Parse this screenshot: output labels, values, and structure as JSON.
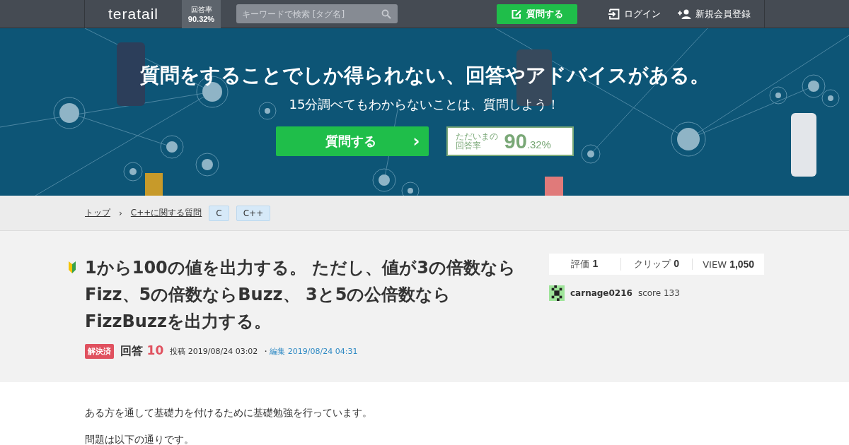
{
  "header": {
    "logo": "teratail",
    "answer_rate": {
      "label": "回答率",
      "value": "90.32%"
    },
    "search": {
      "placeholder": "キーワードで検索 [タグ名]"
    },
    "ask_button": "質問する",
    "login": "ログイン",
    "signup": "新規会員登録"
  },
  "hero": {
    "headline": "質問をすることでしか得られない、回答やアドバイスがある。",
    "subheading": "15分調べてもわからないことは、質問しよう！",
    "ask_button": "質問する",
    "arrow": "›",
    "rate_lines": [
      "ただいまの",
      "回答率"
    ],
    "rate_int": "90",
    "rate_dec": ".32%"
  },
  "breadcrumbs": [
    {
      "label": "トップ",
      "kind": "link"
    },
    {
      "label": "›",
      "kind": "sep"
    },
    {
      "label": "C++に関する質問",
      "kind": "link"
    },
    {
      "label": "C",
      "kind": "tag"
    },
    {
      "label": "C++",
      "kind": "tag"
    }
  ],
  "question": {
    "title": "1から100の値を出力する。 ただし、値が3の倍数ならFizz、5の倍数ならBuzz、 3と5の公倍数ならFizzBuzzを出力する。",
    "status": "解決済",
    "answers_label": "回答",
    "answers_count": "10",
    "posted": "投稿 2019/08/24 03:02",
    "edited_sep": "・",
    "edited": "編集 2019/08/24 04:31",
    "stats": [
      {
        "label": "評価",
        "value": "1"
      },
      {
        "label": "クリップ",
        "value": "0"
      },
      {
        "label": "VIEW",
        "value": "1,050"
      }
    ],
    "user": {
      "name": "carnage0216",
      "score": "score 133"
    }
  },
  "body": [
    "ある方を通して基礎力を付けるために基礎勉強を行っています。",
    "問題は以下の通りです。"
  ]
}
